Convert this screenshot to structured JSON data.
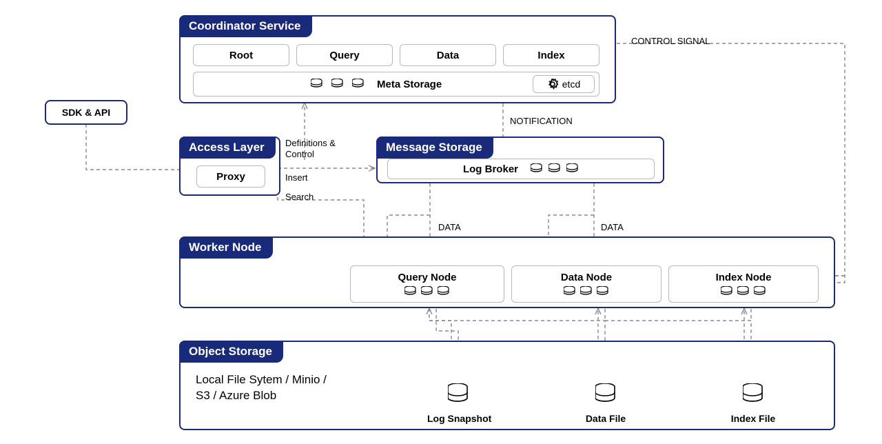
{
  "sdk_api": {
    "label": "SDK & API"
  },
  "coordinator": {
    "title": "Coordinator Service",
    "items": {
      "root": "Root",
      "query": "Query",
      "data": "Data",
      "index": "Index"
    },
    "meta_storage": "Meta Storage",
    "etcd": "etcd"
  },
  "access": {
    "title": "Access Layer",
    "proxy": "Proxy"
  },
  "message": {
    "title": "Message Storage",
    "log_broker": "Log Broker"
  },
  "worker": {
    "title": "Worker Node",
    "query_node": "Query Node",
    "data_node": "Data Node",
    "index_node": "Index Node"
  },
  "object": {
    "title": "Object Storage",
    "note_line1": "Local File Sytem / Minio /",
    "note_line2": "S3 / Azure Blob",
    "log_snapshot": "Log Snapshot",
    "data_file": "Data File",
    "index_file": "Index File"
  },
  "edges": {
    "control_signal": "CONTROL SIGNAL",
    "notification": "NOTIFICATION",
    "def_ctrl_line1": "Definitions &",
    "def_ctrl_line2": "Control",
    "insert": "Insert",
    "search": "Search",
    "data1": "DATA",
    "data2": "DATA"
  }
}
